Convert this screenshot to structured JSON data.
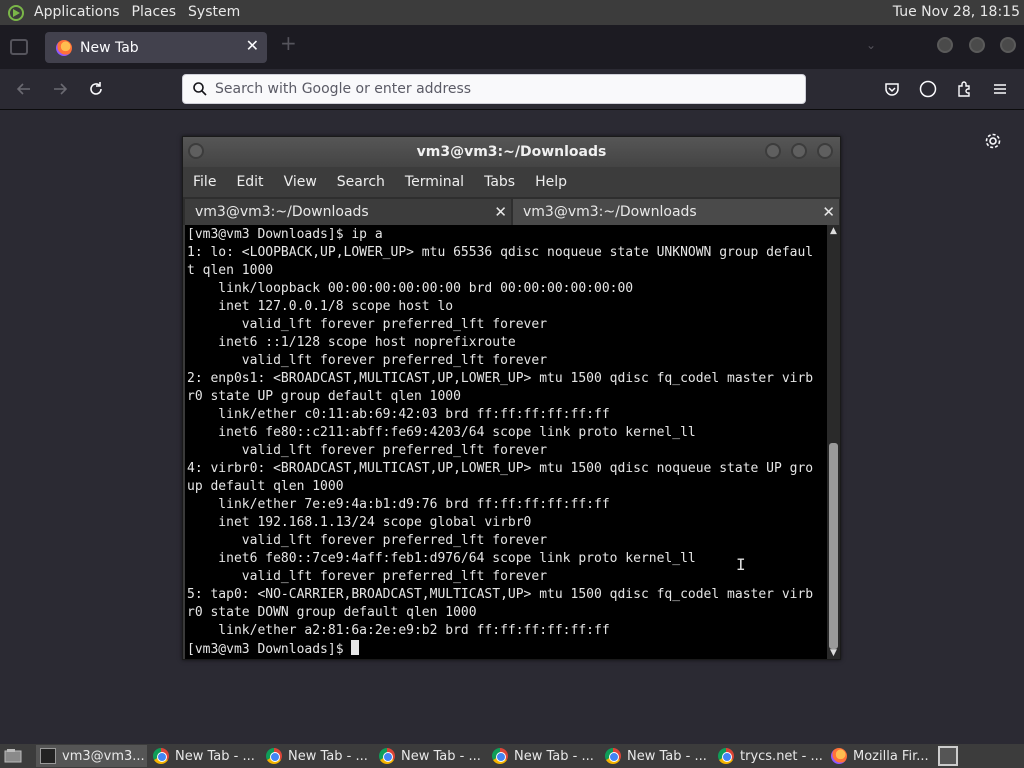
{
  "top_panel": {
    "menus": [
      "Applications",
      "Places",
      "System"
    ],
    "clock": "Tue Nov 28, 18:15"
  },
  "browser": {
    "tab_title": "New Tab",
    "url_placeholder": "Search with Google or enter address"
  },
  "terminal": {
    "title": "vm3@vm3:~/Downloads",
    "menu": [
      "File",
      "Edit",
      "View",
      "Search",
      "Terminal",
      "Tabs",
      "Help"
    ],
    "tabs": [
      "vm3@vm3:~/Downloads",
      "vm3@vm3:~/Downloads"
    ],
    "lines": [
      "[vm3@vm3 Downloads]$ ip a",
      "1: lo: <LOOPBACK,UP,LOWER_UP> mtu 65536 qdisc noqueue state UNKNOWN group defaul",
      "t qlen 1000",
      "    link/loopback 00:00:00:00:00:00 brd 00:00:00:00:00:00",
      "    inet 127.0.0.1/8 scope host lo",
      "       valid_lft forever preferred_lft forever",
      "    inet6 ::1/128 scope host noprefixroute",
      "       valid_lft forever preferred_lft forever",
      "2: enp0s1: <BROADCAST,MULTICAST,UP,LOWER_UP> mtu 1500 qdisc fq_codel master virb",
      "r0 state UP group default qlen 1000",
      "    link/ether c0:11:ab:69:42:03 brd ff:ff:ff:ff:ff:ff",
      "    inet6 fe80::c211:abff:fe69:4203/64 scope link proto kernel_ll",
      "       valid_lft forever preferred_lft forever",
      "4: virbr0: <BROADCAST,MULTICAST,UP,LOWER_UP> mtu 1500 qdisc noqueue state UP gro",
      "up default qlen 1000",
      "    link/ether 7e:e9:4a:b1:d9:76 brd ff:ff:ff:ff:ff:ff",
      "    inet 192.168.1.13/24 scope global virbr0",
      "       valid_lft forever preferred_lft forever",
      "    inet6 fe80::7ce9:4aff:feb1:d976/64 scope link proto kernel_ll",
      "       valid_lft forever preferred_lft forever",
      "5: tap0: <NO-CARRIER,BROADCAST,MULTICAST,UP> mtu 1500 qdisc fq_codel master virb",
      "r0 state DOWN group default qlen 1000",
      "    link/ether a2:81:6a:2e:e9:b2 brd ff:ff:ff:ff:ff:ff"
    ],
    "prompt": "[vm3@vm3 Downloads]$ "
  },
  "taskbar": {
    "items": [
      {
        "label": "vm3@vm3...",
        "icon": "terminal-icon"
      },
      {
        "label": "New Tab - ...",
        "icon": "chrome-icon"
      },
      {
        "label": "New Tab - ...",
        "icon": "chrome-icon"
      },
      {
        "label": "New Tab - ...",
        "icon": "chrome-icon"
      },
      {
        "label": "New Tab - ...",
        "icon": "chrome-icon"
      },
      {
        "label": "New Tab - ...",
        "icon": "chrome-icon"
      },
      {
        "label": "trycs.net - ...",
        "icon": "chrome-icon"
      },
      {
        "label": "Mozilla Fir...",
        "icon": "firefox-icon"
      }
    ]
  }
}
